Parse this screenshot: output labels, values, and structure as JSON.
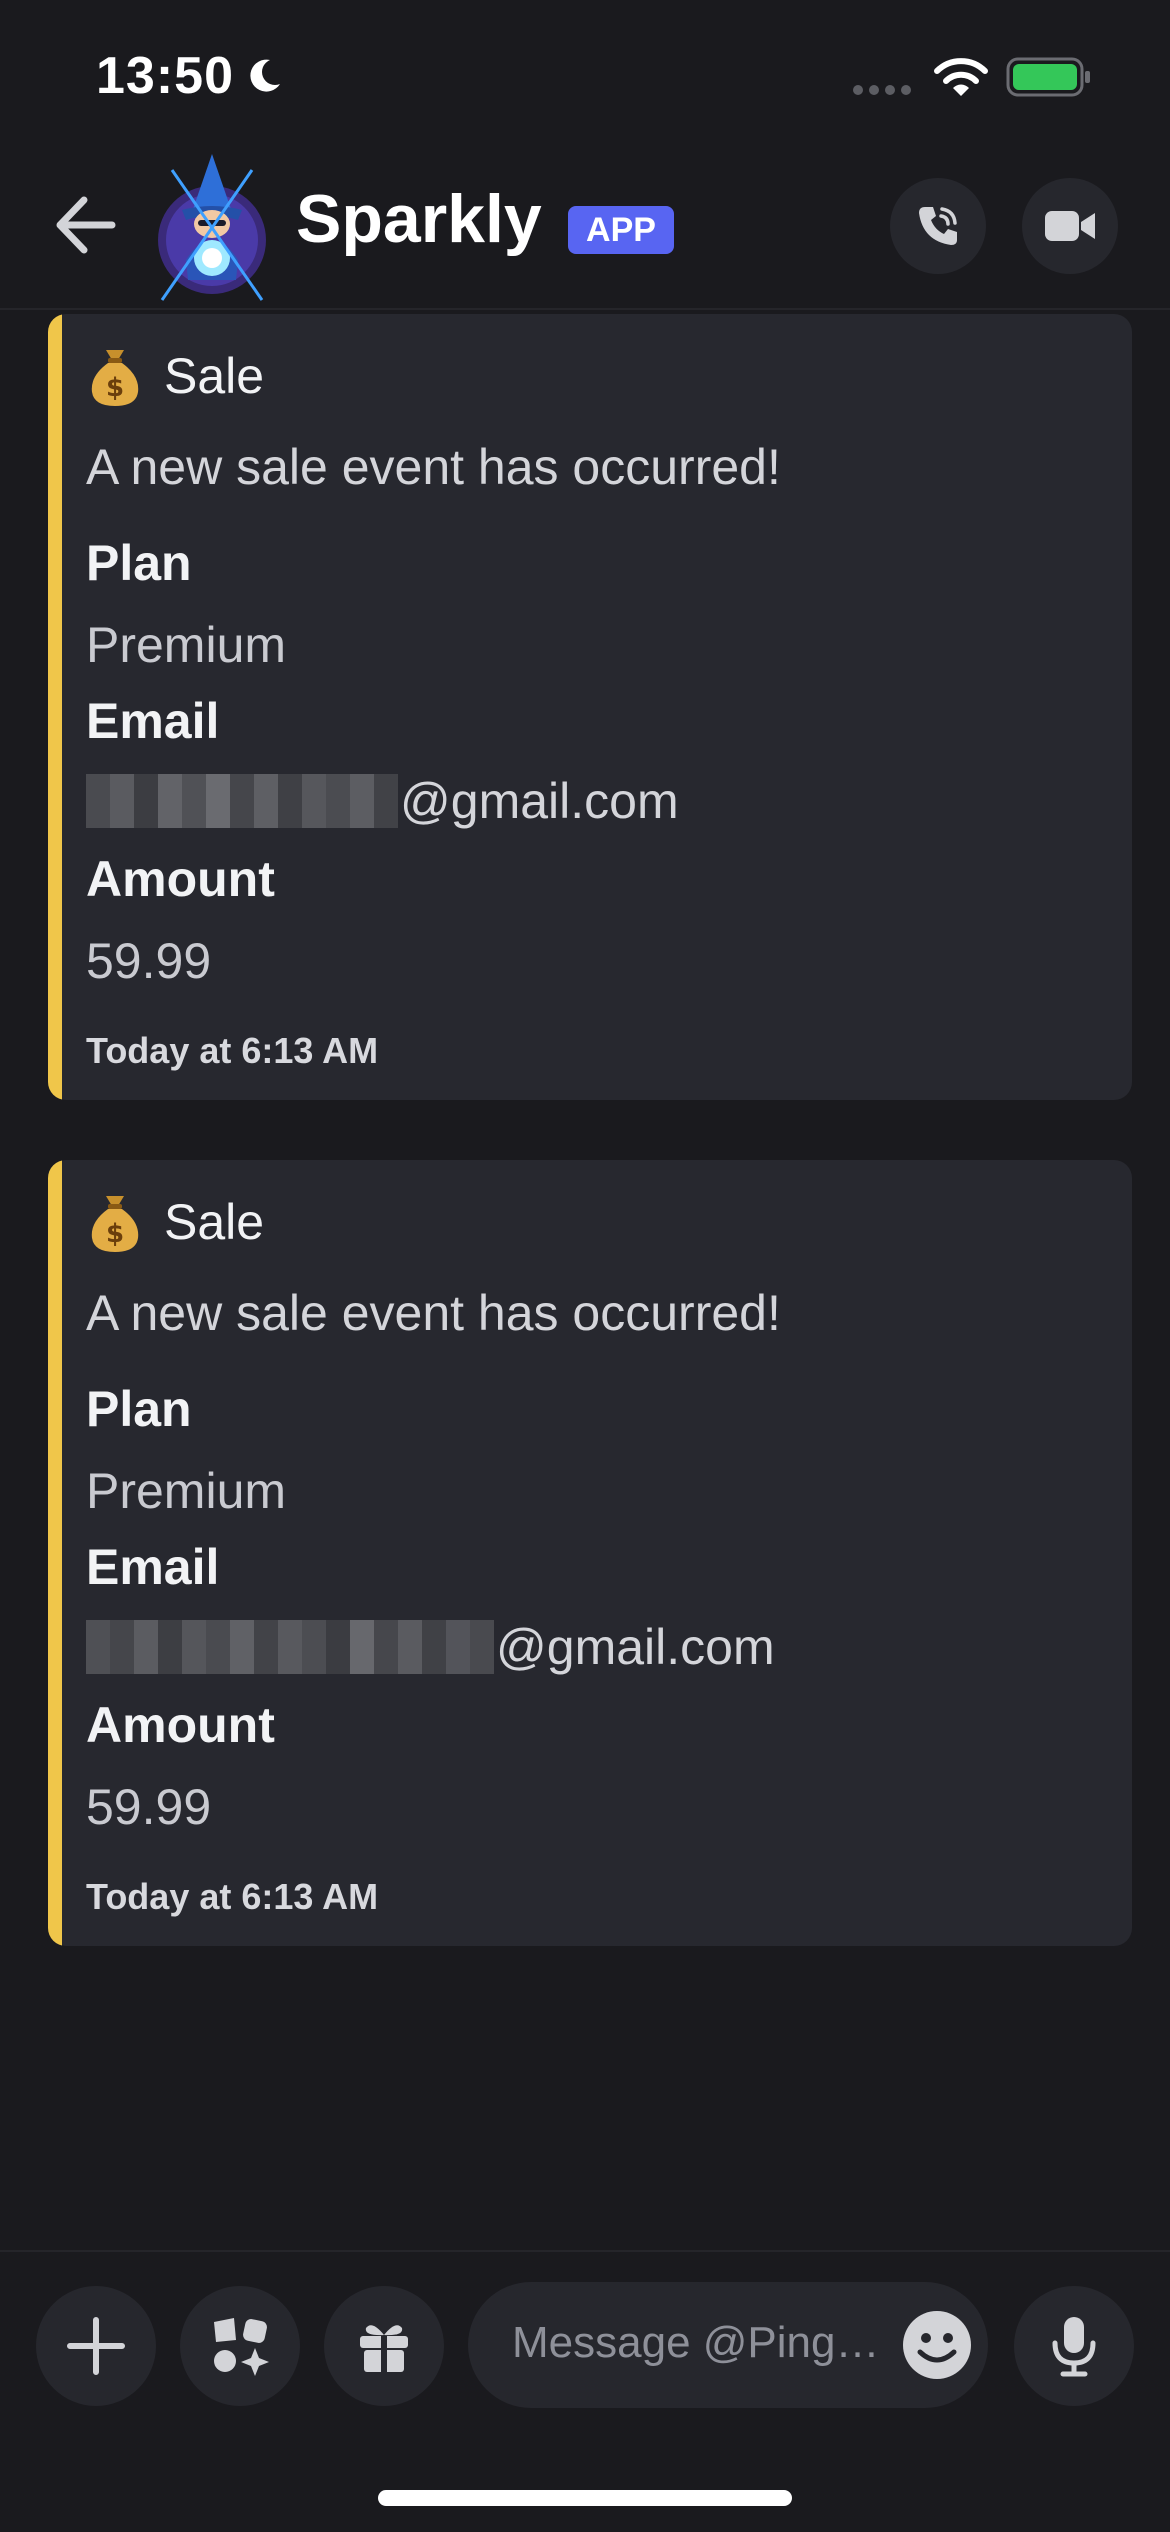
{
  "status_bar": {
    "time": "13:50",
    "icons": [
      "moon-icon",
      "signal-icon",
      "wifi-icon",
      "battery-icon"
    ],
    "battery_color": "#34c759"
  },
  "header": {
    "title": "Sparkly",
    "badge": "APP",
    "icons": [
      "back-arrow-icon",
      "phone-icon",
      "video-camera-icon"
    ]
  },
  "embeds": [
    {
      "title": "Sale",
      "description": "A new sale event has occurred!",
      "fields": [
        {
          "name": "Plan",
          "value": "Premium"
        },
        {
          "name": "Email",
          "value": "@gmail.com"
        },
        {
          "name": "Amount",
          "value": "59.99"
        }
      ],
      "footer": "Today at 6:13 AM"
    },
    {
      "title": "Sale",
      "description": "A new sale event has occurred!",
      "fields": [
        {
          "name": "Plan",
          "value": "Premium"
        },
        {
          "name": "Email",
          "value": "@gmail.com"
        },
        {
          "name": "Amount",
          "value": "59.99"
        }
      ],
      "footer": "Today at 6:13 AM"
    }
  ],
  "composer": {
    "placeholder": "Message @PingP…",
    "icons": [
      "plus-icon",
      "apps-icon",
      "gift-icon",
      "emoji-icon",
      "microphone-icon"
    ]
  },
  "colors": {
    "accent": "#5865f2",
    "embed_bar": "#f0c64a",
    "background": "#1a1a1e"
  }
}
